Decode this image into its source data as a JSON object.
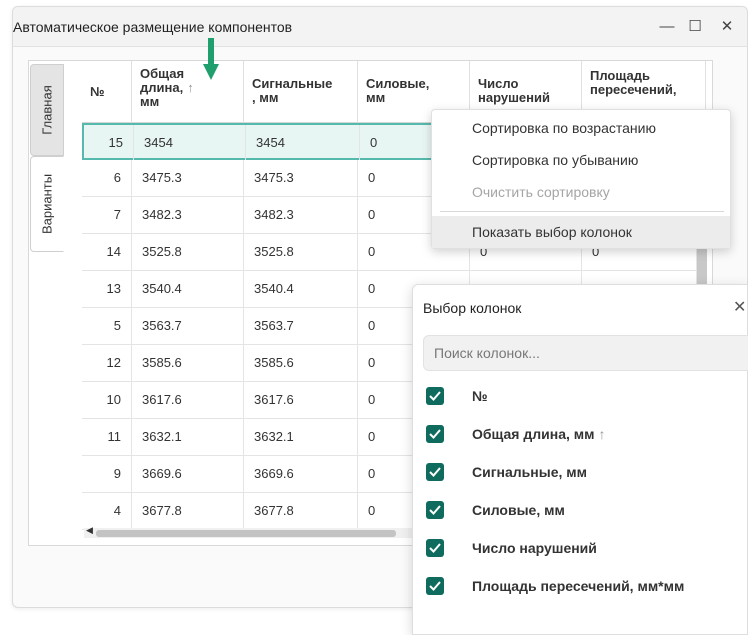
{
  "window": {
    "title": "Автоматическое размещение компонентов",
    "minimize_icon": "—",
    "maximize_icon": "☐",
    "close_icon": "✕"
  },
  "side_tabs": [
    {
      "label": "Главная",
      "active": false
    },
    {
      "label": "Варианты",
      "active": true
    }
  ],
  "table": {
    "columns": [
      {
        "label": "№"
      },
      {
        "label": "Общая длина, мм",
        "line1": "Общая",
        "line2": "длина,",
        "line3": "мм",
        "sort_icon": "↑"
      },
      {
        "label": "Сигнальные, мм",
        "line1": "Сигнальные",
        "line2": ", мм"
      },
      {
        "label": "Силовые, мм",
        "line1": "Силовые,",
        "line2": "мм"
      },
      {
        "label": "Число нарушений",
        "line1": "Число",
        "line2": "нарушений"
      },
      {
        "label": "Площадь пересечений, мм*мм",
        "line1": "Площадь",
        "line2": "пересечений,"
      }
    ],
    "rows": [
      {
        "num": "15",
        "total": "3454",
        "signal": "3454",
        "power": "0",
        "violations": "",
        "area": "",
        "selected": true
      },
      {
        "num": "6",
        "total": "3475.3",
        "signal": "3475.3",
        "power": "0",
        "violations": "",
        "area": ""
      },
      {
        "num": "7",
        "total": "3482.3",
        "signal": "3482.3",
        "power": "0",
        "violations": "",
        "area": ""
      },
      {
        "num": "14",
        "total": "3525.8",
        "signal": "3525.8",
        "power": "0",
        "violations": "0",
        "area": "0"
      },
      {
        "num": "13",
        "total": "3540.4",
        "signal": "3540.4",
        "power": "0",
        "violations": "",
        "area": ""
      },
      {
        "num": "5",
        "total": "3563.7",
        "signal": "3563.7",
        "power": "0",
        "violations": "",
        "area": ""
      },
      {
        "num": "12",
        "total": "3585.6",
        "signal": "3585.6",
        "power": "0",
        "violations": "",
        "area": ""
      },
      {
        "num": "10",
        "total": "3617.6",
        "signal": "3617.6",
        "power": "0",
        "violations": "",
        "area": ""
      },
      {
        "num": "11",
        "total": "3632.1",
        "signal": "3632.1",
        "power": "0",
        "violations": "",
        "area": ""
      },
      {
        "num": "9",
        "total": "3669.6",
        "signal": "3669.6",
        "power": "0",
        "violations": "",
        "area": ""
      },
      {
        "num": "4",
        "total": "3677.8",
        "signal": "3677.8",
        "power": "0",
        "violations": "",
        "area": ""
      }
    ]
  },
  "context_menu": {
    "items": [
      {
        "label": "Сортировка по возрастанию",
        "enabled": true
      },
      {
        "label": "Сортировка по убыванию",
        "enabled": true
      },
      {
        "label": "Очистить сортировку",
        "enabled": false
      },
      {
        "label": "Показать выбор колонок",
        "enabled": true,
        "hovered": true
      }
    ]
  },
  "column_picker": {
    "title": "Выбор колонок",
    "close_icon": "✕",
    "search_placeholder": "Поиск колонок...",
    "items": [
      {
        "label": "№",
        "checked": true
      },
      {
        "label": "Общая длина, мм",
        "checked": true,
        "sort_icon": "↑"
      },
      {
        "label": "Сигнальные, мм",
        "checked": true
      },
      {
        "label": "Силовые, мм",
        "checked": true
      },
      {
        "label": "Число нарушений",
        "checked": true
      },
      {
        "label": "Площадь пересечений, мм*мм",
        "checked": true
      }
    ]
  },
  "colors": {
    "accent": "#0f6b5d",
    "selection_fill": "#e7f5f3",
    "selection_border": "#56b9ad",
    "annotation_arrow": "#1f9e6e"
  }
}
